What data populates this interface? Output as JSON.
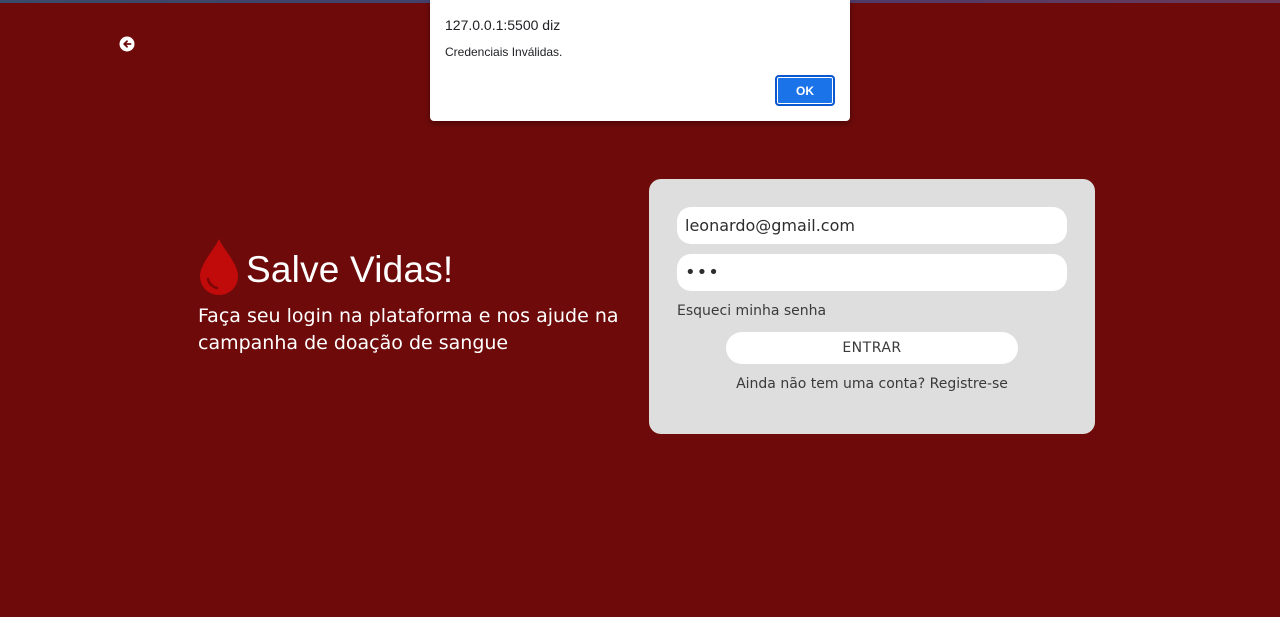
{
  "colors": {
    "background": "#6e0a0a",
    "card": "#dedede",
    "drop": "#c10a0a",
    "ok_button": "#1a73e8"
  },
  "header": {
    "back_icon": "arrow-left-circle-icon"
  },
  "hero": {
    "icon": "blood-drop-icon",
    "title": "Salve Vidas!",
    "description": "Faça seu login na plataforma e nos ajude na campanha de doação de sangue"
  },
  "login": {
    "email_value": "leonardo@gmail.com",
    "password_value": "•••",
    "forgot_label": "Esqueci minha senha",
    "submit_label": "ENTRAR",
    "register_prompt": "Ainda não tem uma conta?",
    "register_link": "Registre-se"
  },
  "alert": {
    "origin": "127.0.0.1:5500 diz",
    "message": "Credenciais Inválidas.",
    "ok_label": "OK"
  }
}
